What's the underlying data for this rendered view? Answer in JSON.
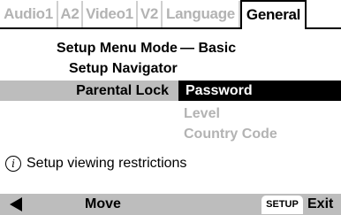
{
  "tabs": [
    {
      "label": "Audio1",
      "active": false
    },
    {
      "label": "A2",
      "active": false
    },
    {
      "label": "Video1",
      "active": false
    },
    {
      "label": "V2",
      "active": false
    },
    {
      "label": "Language",
      "active": false
    },
    {
      "label": "General",
      "active": true
    }
  ],
  "menu": {
    "setup_mode_label": "Setup Menu Mode",
    "setup_mode_value": "— Basic",
    "navigator_label": "Setup Navigator",
    "parental_lock_label": "Parental Lock",
    "submenu": {
      "password": "Password",
      "level": "Level",
      "country_code": "Country Code"
    }
  },
  "help": {
    "icon": "info-icon",
    "text": "Setup viewing restrictions"
  },
  "footer": {
    "back_icon": "back-arrow-icon",
    "move_label": "Move",
    "setup_key": "SETUP",
    "exit_label": "Exit"
  },
  "colors": {
    "highlight": "#bdbdbd",
    "selected_bg": "#000000",
    "dim_text": "#b3b3b3"
  }
}
